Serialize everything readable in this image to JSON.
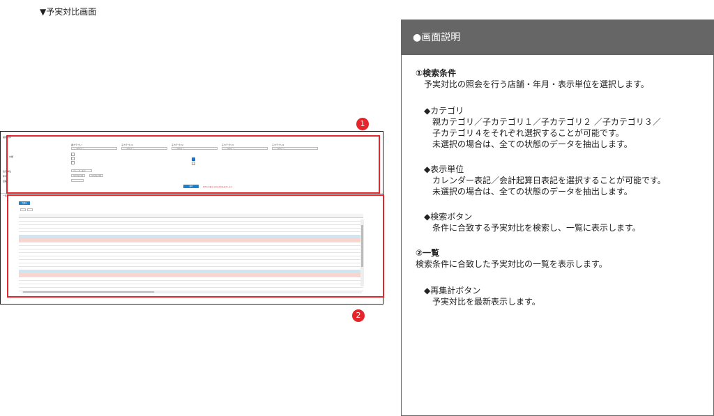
{
  "page_title": "▼予実対比画面",
  "mock": {
    "search_label": "検索条件",
    "category_label": "分類",
    "category_headers": [
      "親カテゴリ",
      "子カテゴリ1",
      "子カテゴリ2",
      "子カテゴリ3",
      "子カテゴリ4"
    ],
    "select_placeholder": "---- select ----",
    "unit_label": "表示単位",
    "unit_value": "カレンダー表記",
    "period_label": "年月",
    "period_from": "2023年01月",
    "period_to": "2023年03月",
    "store_label": "店舗",
    "search_button": "検索",
    "note": "条件に合致する予実対比を表示します",
    "list_label": "一覧",
    "recalc_button": "再集計"
  },
  "markers": [
    "1",
    "2"
  ],
  "panel": {
    "header": "●画面説明",
    "sections": [
      {
        "title": "①検索条件",
        "desc": "予実対比の照会を行う店舗・年月・表示単位を選択します。",
        "items": [
          {
            "title": "◆カテゴリ",
            "lines": [
              "親カテゴリ／子カテゴリ１／子カテゴリ２ ／子カテゴリ３／",
              "子カテゴリ４をそれぞれ選択することが可能です。",
              "未選択の場合は、全ての状態のデータを抽出します。"
            ]
          },
          {
            "title": "◆表示単位",
            "lines": [
              "カレンダー表記／会計起算日表記を選択することが可能です。",
              "未選択の場合は、全ての状態のデータを抽出します。"
            ]
          },
          {
            "title": "◆検索ボタン",
            "lines": [
              "条件に合致する予実対比を検索し、一覧に表示します。"
            ]
          }
        ]
      },
      {
        "title": "②一覧",
        "desc": "検索条件に合致した予実対比の一覧を表示します。",
        "items": [
          {
            "title": "◆再集計ボタン",
            "lines": [
              "予実対比を最新表示します。"
            ]
          }
        ]
      }
    ]
  },
  "colors": {
    "accent_red": "#e5252a",
    "panel_header": "#666666",
    "button_blue": "#1e82c8"
  }
}
